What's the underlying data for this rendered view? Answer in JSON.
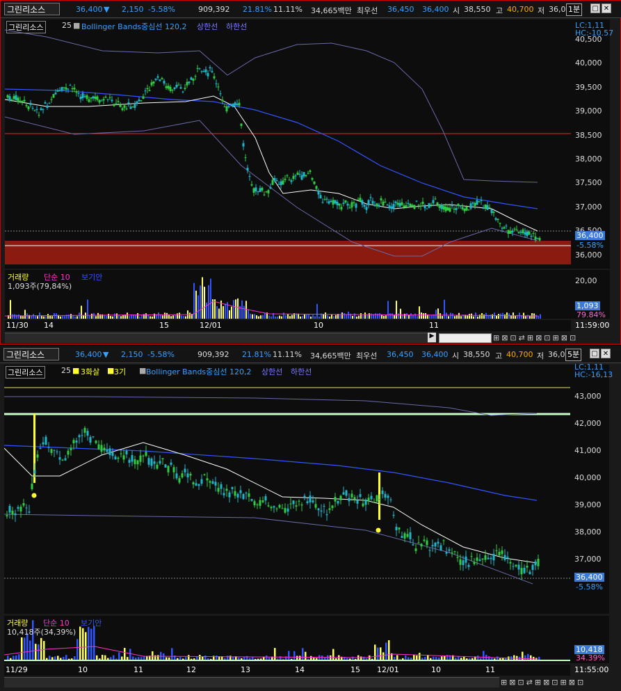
{
  "header": {
    "name": "그린리소스",
    "price": "36,400",
    "change": "2,150",
    "change_pct": "-5.58%",
    "volume": "909,392",
    "turnover": "21.81%",
    "ratio": "11.11%",
    "amount": "34,665백만",
    "best_label": "최우선",
    "best_ask": "36,450",
    "best_bid": "36,400",
    "open_label": "시",
    "open": "38,550",
    "high_label": "고",
    "high": "40,700",
    "low_label": "저",
    "low_cut": "36,0"
  },
  "panel1": {
    "timeframe": "1분",
    "code": "그린리소스",
    "period": "25",
    "bb_label": "Bollinger Bands중심선 120,2",
    "upper_label": "상한선",
    "lower_label": "하한선",
    "lc": "LC:1,11",
    "hc": "HC:-10.57",
    "y_ticks": [
      "40,500",
      "40,000",
      "39,500",
      "39,000",
      "38,500",
      "38,000",
      "37,500",
      "37,000",
      "36,500",
      "36,000"
    ],
    "price_tag": "36,400",
    "pct_tag": "-5.58%",
    "vol_title": "거래량",
    "vol_ma": "단순 10",
    "vol_extra": "보기안",
    "vol_value": "1,093주(79,84%)",
    "vol_tick": "20,00",
    "vol_tag": "1,093",
    "vol_pct_tag": "79.84%",
    "x_labels": [
      "11/30",
      "14",
      "15",
      "12/01",
      "10",
      "11"
    ],
    "time": "11:59:00"
  },
  "panel2": {
    "timeframe": "5분",
    "code": "그린리소스",
    "period": "25",
    "ind1": "3화살",
    "ind2": "3기",
    "bb_label": "Bollinger Bands중심선 120,2",
    "upper_label": "상한선",
    "lower_label": "하한선",
    "lc": "LC:1,11",
    "hc": "HC:-16,13",
    "y_ticks": [
      "43,000",
      "42,000",
      "41,000",
      "40,000",
      "39,000",
      "38,000",
      "37,000"
    ],
    "price_tag": "36,400",
    "pct_tag": "-5.58%",
    "vol_title": "거래량",
    "vol_ma": "단순 10",
    "vol_extra": "보기안",
    "vol_value": "10,418주(34,39%)",
    "vol_tag": "10,418",
    "vol_pct_tag": "34.39%",
    "x_labels": [
      "11/29",
      "10",
      "11",
      "12",
      "13",
      "14",
      "15",
      "12/01",
      "10",
      "11"
    ],
    "time": "11:55:00"
  },
  "colors": {
    "up": "#2ecc40",
    "down": "#1fb5c9",
    "bb_mid": "#3355ff",
    "bb_band": "#6a6aa8",
    "ma": "#ffffff",
    "red_band": "#8b1a10",
    "yellow": "#ffff33"
  }
}
